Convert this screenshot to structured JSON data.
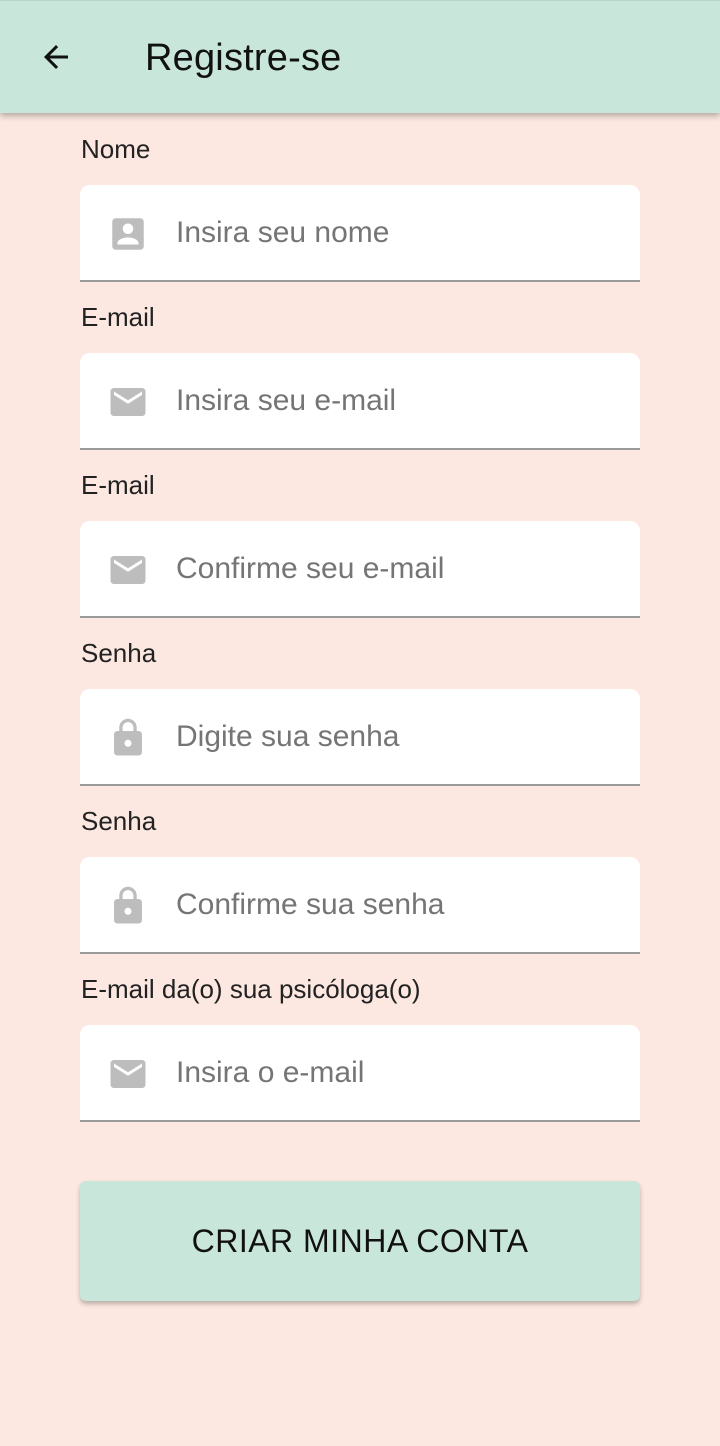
{
  "appbar": {
    "back_icon": "arrow-left-icon",
    "title": "Registre-se"
  },
  "form": {
    "fields": [
      {
        "label": "Nome",
        "placeholder": "Insira seu nome",
        "value": "",
        "icon": "person-icon"
      },
      {
        "label": "E-mail",
        "placeholder": "Insira seu e-mail",
        "value": "",
        "icon": "mail-icon"
      },
      {
        "label": "E-mail",
        "placeholder": "Confirme seu e-mail",
        "value": "",
        "icon": "mail-icon"
      },
      {
        "label": "Senha",
        "placeholder": "Digite sua senha",
        "value": "",
        "icon": "lock-icon"
      },
      {
        "label": "Senha",
        "placeholder": "Confirme sua senha",
        "value": "",
        "icon": "lock-icon"
      },
      {
        "label": "E-mail da(o) sua psicóloga(o)",
        "placeholder": "Insira o e-mail",
        "value": "",
        "icon": "mail-icon"
      }
    ],
    "submit_label": "CRIAR MINHA CONTA"
  },
  "colors": {
    "background": "#fce8e1",
    "appbar": "#c9e6db",
    "button": "#c9e6db",
    "field_background": "#ffffff",
    "icon_gray": "#bdbdbd"
  }
}
